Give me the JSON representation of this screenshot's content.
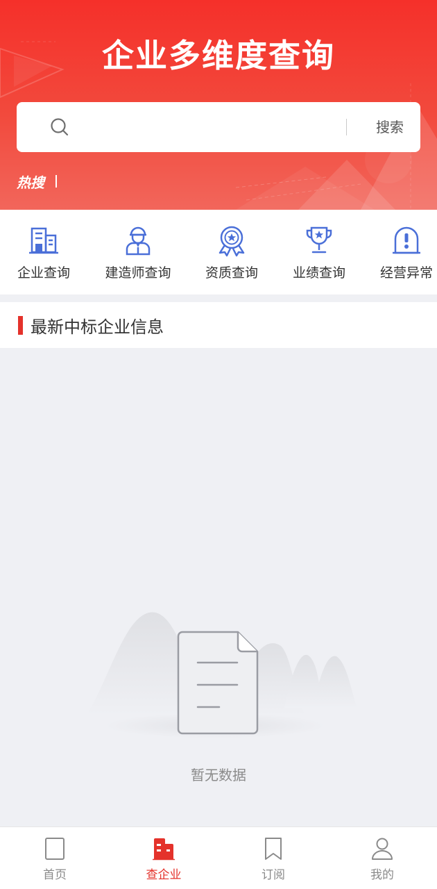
{
  "header": {
    "title": "企业多维度查询",
    "hot_label": "热搜"
  },
  "search": {
    "placeholder": "",
    "value": "",
    "button_label": "搜索"
  },
  "categories": [
    {
      "label": "企业查询",
      "icon": "building-icon"
    },
    {
      "label": "建造师查询",
      "icon": "builder-person-icon"
    },
    {
      "label": "资质查询",
      "icon": "award-badge-icon"
    },
    {
      "label": "业绩查询",
      "icon": "trophy-icon"
    },
    {
      "label": "经营异常",
      "icon": "alert-tombstone-icon"
    }
  ],
  "section": {
    "title": "最新中标企业信息"
  },
  "empty_state": {
    "text": "暂无数据",
    "icon": "empty-document-icon"
  },
  "tabbar": {
    "items": [
      {
        "label": "首页",
        "icon": "home-square-icon",
        "active": false
      },
      {
        "label": "查企业",
        "icon": "company-search-icon",
        "active": true
      },
      {
        "label": "订阅",
        "icon": "bookmark-icon",
        "active": false
      },
      {
        "label": "我的",
        "icon": "user-icon",
        "active": false
      }
    ]
  },
  "colors": {
    "brand_red": "#e4322b",
    "icon_blue": "#4a6fd8",
    "page_bg": "#eff0f4"
  }
}
